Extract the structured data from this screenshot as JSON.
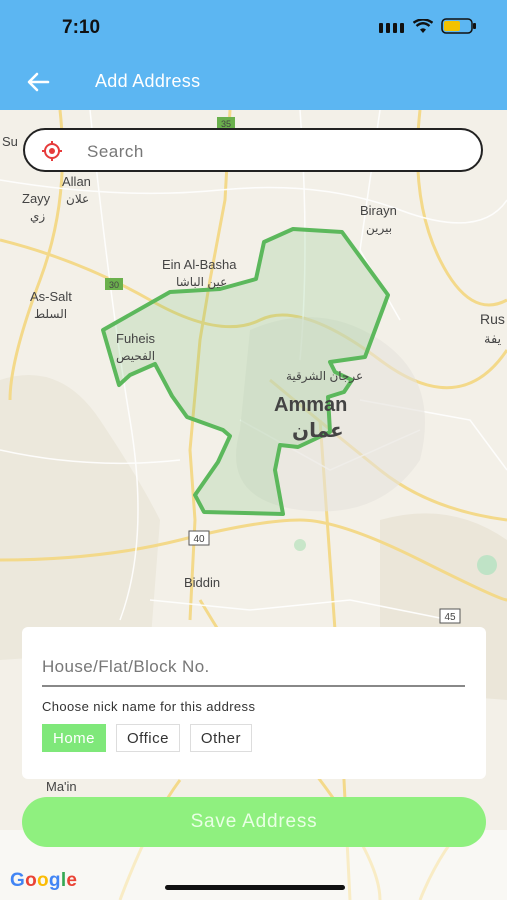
{
  "status": {
    "time": "7:10",
    "battery_color": "#f2c200"
  },
  "header": {
    "title": "Add Address",
    "back_icon": "arrow-left-icon",
    "background": "#5cb6f2"
  },
  "search": {
    "placeholder": "Search",
    "value": "",
    "icon": "location-pin-icon"
  },
  "map": {
    "places": {
      "su": "Su",
      "allan_en": "Allan",
      "allan_ar": "علان",
      "zayy_en": "Zayy",
      "zayy_ar": "زي",
      "birayn_en": "Birayn",
      "birayn_ar": "بيرين",
      "ein_en": "Ein Al-Basha",
      "ein_ar": "عين الباشا",
      "assalt_en": "As-Salt",
      "assalt_ar": "السلط",
      "fuheis_en": "Fuheis",
      "fuheis_ar": "الفحيص",
      "rus": "Rus",
      "rus_ar": "يفة",
      "sharqiya_ar": "عرجان الشرقية",
      "amman_en": "Amman",
      "amman_ar": "عمان",
      "biddin": "Biddin",
      "main": "Ma'in",
      "r35": "35",
      "r30": "30",
      "r40": "40",
      "r45": "45"
    },
    "zone_color": "#5cb85c"
  },
  "form": {
    "house_placeholder": "House/Flat/Block No.",
    "house_value": "",
    "nick_label": "Choose nick name for this address",
    "nicknames": [
      {
        "label": "Home",
        "selected": true
      },
      {
        "label": "Office",
        "selected": false
      },
      {
        "label": "Other",
        "selected": false
      }
    ],
    "selected_color": "#7fe87a"
  },
  "save_button": {
    "label": "Save Address",
    "color": "#8ff07f"
  },
  "attribution": {
    "google": "Google"
  }
}
